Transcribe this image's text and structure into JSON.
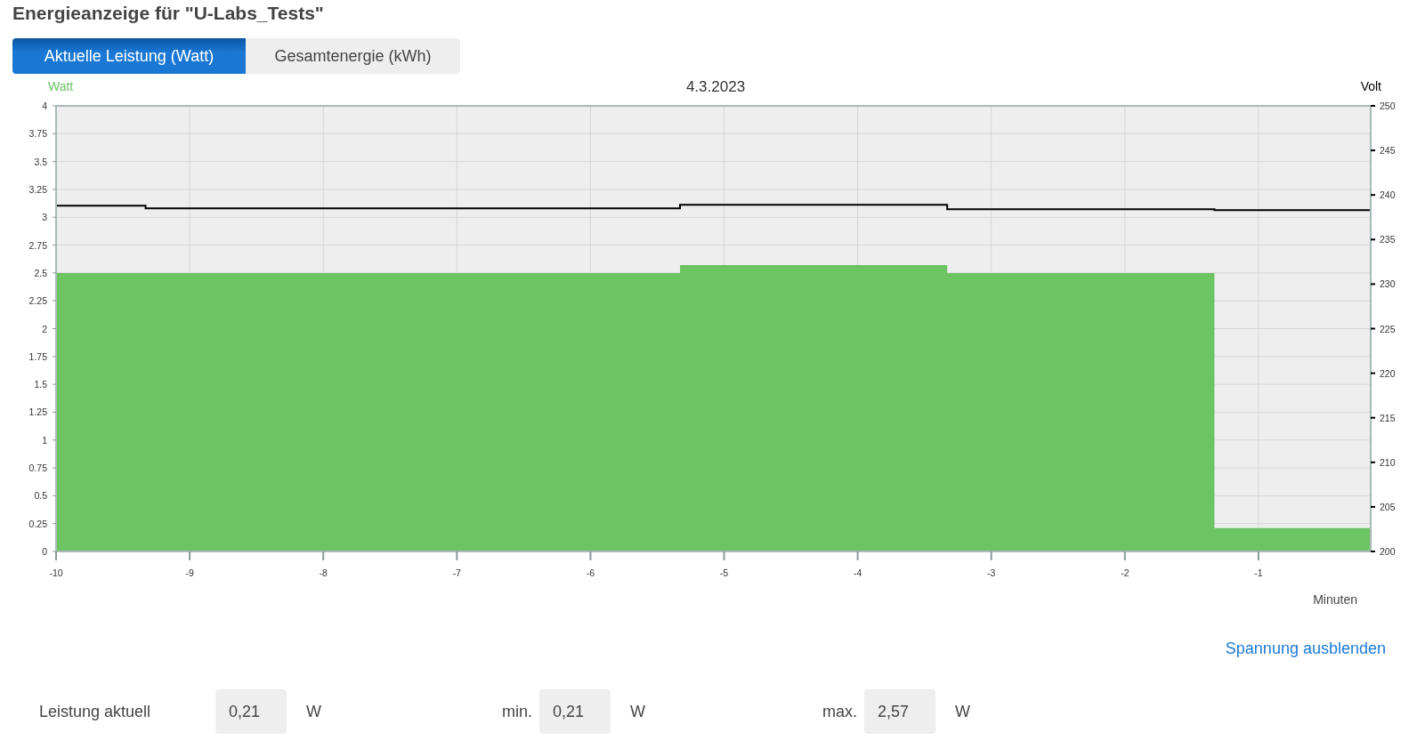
{
  "title": "Energieanzeige für \"U-Labs_Tests\"",
  "tabs": [
    {
      "label": "Aktuelle Leistung (Watt)",
      "selected": true
    },
    {
      "label": "Gesamtenergie (kWh)",
      "selected": false
    }
  ],
  "chart": {
    "chart_data": {
      "type": "area",
      "title": "4.3.2023",
      "xlabel": "Minuten",
      "x": [
        -10,
        -9.33,
        -5.33,
        -3.33,
        -1.33,
        -0.16
      ],
      "series": [
        {
          "name": "Watt",
          "color": "#6cc463",
          "values": [
            2.5,
            2.5,
            2.57,
            2.5,
            0.21,
            0.21
          ]
        },
        {
          "name": "Volt",
          "color": "#000000",
          "axis": "y2",
          "type": "line",
          "values": [
            238.8,
            238.5,
            238.9,
            238.4,
            238.3,
            238.3
          ]
        }
      ],
      "grid": true,
      "xlim": [
        -10,
        -0.16
      ],
      "ylim": [
        0,
        4
      ],
      "y2lim": [
        200,
        250
      ],
      "xticks": [
        -10,
        -9,
        -8,
        -7,
        -6,
        -5,
        -4,
        -3,
        -2,
        -1
      ],
      "yticks": [
        0,
        0.25,
        0.5,
        0.75,
        1,
        1.25,
        1.5,
        1.75,
        2,
        2.25,
        2.5,
        2.75,
        3,
        3.25,
        3.5,
        3.75,
        4
      ],
      "y2ticks": [
        200,
        205,
        210,
        215,
        220,
        225,
        230,
        235,
        240,
        245,
        250
      ]
    }
  },
  "toggle_link": "Spannung ausblenden",
  "stats": {
    "label": "Leistung aktuell",
    "current": "0,21",
    "current_unit": "W",
    "min_label": "min.",
    "min": "0,21",
    "min_unit": "W",
    "max_label": "max.",
    "max": "2,57",
    "max_unit": "W"
  }
}
